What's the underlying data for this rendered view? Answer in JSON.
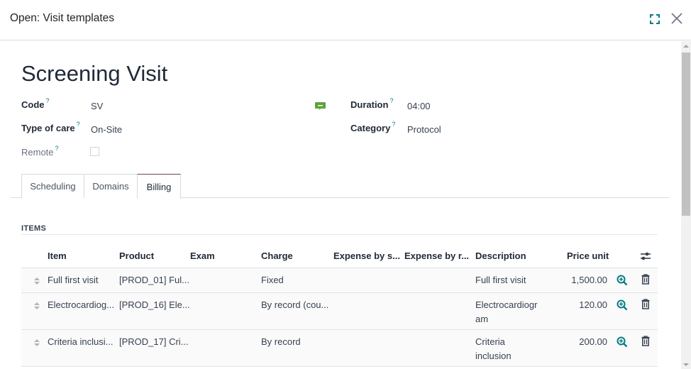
{
  "modal": {
    "title": "Open: Visit templates"
  },
  "record": {
    "title": "Screening Visit",
    "fields_left": [
      {
        "label": "Code",
        "help": "?",
        "value": "SV"
      },
      {
        "label": "Type of care",
        "help": "?",
        "value": "On-Site"
      },
      {
        "label": "Remote",
        "help": "?",
        "checked": false
      }
    ],
    "fields_right": [
      {
        "label": "Duration",
        "help": "?",
        "value": "04:00"
      },
      {
        "label": "Category",
        "help": "?",
        "value": "Protocol"
      }
    ]
  },
  "tabs": [
    {
      "label": "Scheduling",
      "active": false
    },
    {
      "label": "Domains",
      "active": false
    },
    {
      "label": "Billing",
      "active": true
    }
  ],
  "items": {
    "section_title": "ITEMS",
    "columns": [
      "Item",
      "Product",
      "Exam",
      "Charge",
      "Expense by s...",
      "Expense by r...",
      "Description",
      "Price unit"
    ],
    "rows": [
      {
        "item": "Full first visit",
        "product": "[PROD_01] Ful...",
        "exam": "",
        "charge": "Fixed",
        "expense_s": "",
        "expense_r": "",
        "description": "Full first visit",
        "price_unit": "1,500.00"
      },
      {
        "item": "Electrocardiog...",
        "product": "[PROD_16] Ele...",
        "exam": "",
        "charge": "By record (cou...",
        "expense_s": "",
        "expense_r": "",
        "description": "Electrocardiogram",
        "price_unit": "120.00"
      },
      {
        "item": "Criteria inclusi...",
        "product": "[PROD_17] Cri...",
        "exam": "",
        "charge": "By record",
        "expense_s": "",
        "expense_r": "",
        "description": "Criteria inclusion",
        "price_unit": "200.00"
      }
    ]
  },
  "colors": {
    "accent": "#017e84",
    "tab_active_border": "#71405f",
    "chat_icon": "#5aa43c"
  }
}
